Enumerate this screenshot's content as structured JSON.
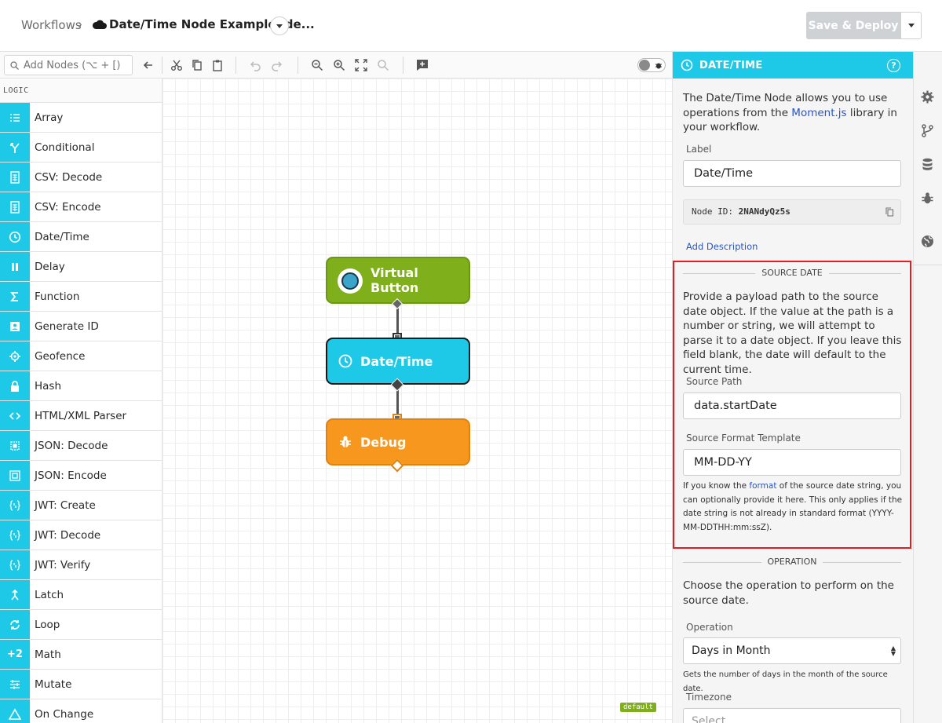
{
  "header": {
    "breadcrumb_root": "Workflows",
    "breadcrumb_sep": "›",
    "title": "Date/Time Node Example: de...",
    "deploy_label": "Save & Deploy"
  },
  "toolbar": {
    "search_placeholder": "Add Nodes (⌥ + [)"
  },
  "palette": {
    "category": "LOGIC",
    "items": [
      {
        "label": "Array",
        "icon": "list-icon"
      },
      {
        "label": "Conditional",
        "icon": "branch-icon"
      },
      {
        "label": "CSV: Decode",
        "icon": "csv-icon"
      },
      {
        "label": "CSV: Encode",
        "icon": "csv-icon"
      },
      {
        "label": "Date/Time",
        "icon": "clock-icon"
      },
      {
        "label": "Delay",
        "icon": "pause-icon"
      },
      {
        "label": "Function",
        "icon": "sigma-icon"
      },
      {
        "label": "Generate ID",
        "icon": "id-badge-icon"
      },
      {
        "label": "Geofence",
        "icon": "crosshair-icon"
      },
      {
        "label": "Hash",
        "icon": "lock-icon"
      },
      {
        "label": "HTML/XML Parser",
        "icon": "code-icon"
      },
      {
        "label": "JSON: Decode",
        "icon": "json-decode-icon"
      },
      {
        "label": "JSON: Encode",
        "icon": "json-encode-icon"
      },
      {
        "label": "JWT: Create",
        "icon": "jwt-icon"
      },
      {
        "label": "JWT: Decode",
        "icon": "jwt-icon"
      },
      {
        "label": "JWT: Verify",
        "icon": "jwt-icon"
      },
      {
        "label": "Latch",
        "icon": "latch-icon"
      },
      {
        "label": "Loop",
        "icon": "loop-icon"
      },
      {
        "label": "Math",
        "icon": "math-icon",
        "glyph": "+2"
      },
      {
        "label": "Mutate",
        "icon": "mutate-icon"
      },
      {
        "label": "On Change",
        "icon": "triangle-icon"
      }
    ]
  },
  "canvas": {
    "nodes": {
      "virtual_button": "Virtual Button",
      "date_time": "Date/Time",
      "debug": "Debug"
    },
    "badge": "default"
  },
  "panel": {
    "title": "DATE/TIME",
    "help": "?",
    "intro_before": "The Date/Time Node allows you to use operations from the ",
    "intro_link": "Moment.js",
    "intro_after": " library in your workflow.",
    "label_label": "Label",
    "label_value": "Date/Time",
    "node_id_label": "Node ID:",
    "node_id_value": "2NANdyQz5s",
    "add_description": "Add Description",
    "source_section": "SOURCE DATE",
    "source_desc": "Provide a payload path to the source date object. If the value at the path is a number or string, we will attempt to parse it to a date object. If you leave this field blank, the date will default to the current time.",
    "source_path_label": "Source Path",
    "source_path_value": "data.startDate",
    "source_format_label": "Source Format Template",
    "source_format_value": "MM-DD-YY",
    "format_help_before": "If you know the ",
    "format_help_link": "format",
    "format_help_after": " of the source date string, you can optionally provide it here. This only applies if the date string is not already in standard format (YYYY-MM-DDTHH:mm:ssZ).",
    "operation_section": "OPERATION",
    "operation_desc": "Choose the operation to perform on the source date.",
    "operation_label": "Operation",
    "operation_value": "Days in Month",
    "operation_help": "Gets the number of days in the month of the source date.",
    "timezone_label": "Timezone",
    "timezone_value": "Select..."
  },
  "colors": {
    "accent": "#1ec9e8",
    "virtual_button": "#7faf1b",
    "debug": "#f8971d",
    "highlight": "#e02020",
    "link": "#2855c6"
  }
}
